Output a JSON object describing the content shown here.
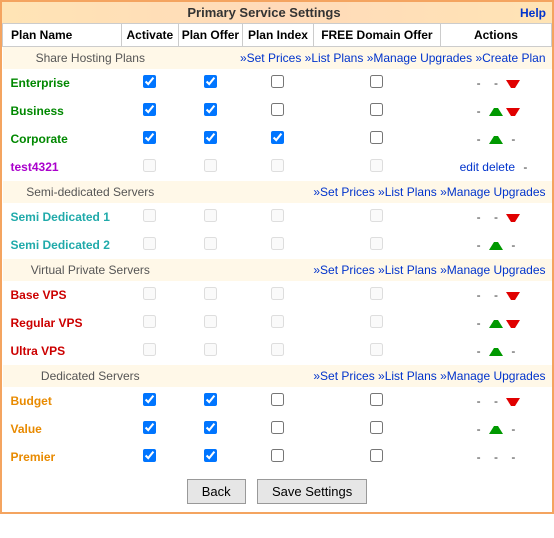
{
  "title": "Primary Service Settings",
  "help_label": "Help",
  "columns": {
    "plan_name": "Plan Name",
    "activate": "Activate",
    "plan_offer": "Plan Offer",
    "plan_index": "Plan Index",
    "free_domain": "FREE Domain Offer",
    "actions": "Actions"
  },
  "groups": [
    {
      "name": "Share Hosting Plans",
      "links": [
        {
          "text": "»Set Prices",
          "key": "set-prices"
        },
        {
          "text": "»List Plans",
          "key": "list-plans"
        },
        {
          "text": "»Manage Upgrades",
          "key": "manage-upgrades"
        },
        {
          "text": "»Create Plan",
          "key": "create-plan"
        }
      ],
      "rows": [
        {
          "name": "Enterprise",
          "css": "c-green",
          "activate": true,
          "offer": true,
          "index": false,
          "free": false,
          "disabled": false,
          "actions": [
            {
              "t": "dash"
            },
            {
              "t": "dash"
            },
            {
              "t": "down"
            }
          ]
        },
        {
          "name": "Business",
          "css": "c-green",
          "activate": true,
          "offer": true,
          "index": false,
          "free": false,
          "disabled": false,
          "actions": [
            {
              "t": "dash"
            },
            {
              "t": "up"
            },
            {
              "t": "down"
            }
          ]
        },
        {
          "name": "Corporate",
          "css": "c-green",
          "activate": true,
          "offer": true,
          "index": true,
          "free": false,
          "disabled": false,
          "actions": [
            {
              "t": "dash"
            },
            {
              "t": "up"
            },
            {
              "t": "dash"
            }
          ]
        },
        {
          "name": "test4321",
          "css": "c-purple",
          "activate": false,
          "offer": false,
          "index": false,
          "free": false,
          "disabled": true,
          "actions": [
            {
              "t": "link",
              "text": "edit"
            },
            {
              "t": "link",
              "text": "delete"
            },
            {
              "t": "dash"
            }
          ]
        }
      ]
    },
    {
      "name": "Semi-dedicated Servers",
      "links": [
        {
          "text": "»Set Prices",
          "key": "set-prices"
        },
        {
          "text": "»List Plans",
          "key": "list-plans"
        },
        {
          "text": "»Manage Upgrades",
          "key": "manage-upgrades"
        }
      ],
      "rows": [
        {
          "name": "Semi Dedicated 1",
          "css": "c-teal",
          "activate": false,
          "offer": false,
          "index": false,
          "free": false,
          "disabled": true,
          "actions": [
            {
              "t": "dash"
            },
            {
              "t": "dash"
            },
            {
              "t": "down"
            }
          ]
        },
        {
          "name": "Semi Dedicated 2",
          "css": "c-teal",
          "activate": false,
          "offer": false,
          "index": false,
          "free": false,
          "disabled": true,
          "actions": [
            {
              "t": "dash"
            },
            {
              "t": "up"
            },
            {
              "t": "dash"
            }
          ]
        }
      ]
    },
    {
      "name": "Virtual Private Servers",
      "links": [
        {
          "text": "»Set Prices",
          "key": "set-prices"
        },
        {
          "text": "»List Plans",
          "key": "list-plans"
        },
        {
          "text": "»Manage Upgrades",
          "key": "manage-upgrades"
        }
      ],
      "rows": [
        {
          "name": "Base VPS",
          "css": "c-red",
          "activate": false,
          "offer": false,
          "index": false,
          "free": false,
          "disabled": true,
          "actions": [
            {
              "t": "dash"
            },
            {
              "t": "dash"
            },
            {
              "t": "down"
            }
          ]
        },
        {
          "name": "Regular VPS",
          "css": "c-red",
          "activate": false,
          "offer": false,
          "index": false,
          "free": false,
          "disabled": true,
          "actions": [
            {
              "t": "dash"
            },
            {
              "t": "up"
            },
            {
              "t": "down"
            }
          ]
        },
        {
          "name": "Ultra VPS",
          "css": "c-red",
          "activate": false,
          "offer": false,
          "index": false,
          "free": false,
          "disabled": true,
          "actions": [
            {
              "t": "dash"
            },
            {
              "t": "up"
            },
            {
              "t": "dash"
            }
          ]
        }
      ]
    },
    {
      "name": "Dedicated Servers",
      "links": [
        {
          "text": "»Set Prices",
          "key": "set-prices"
        },
        {
          "text": "»List Plans",
          "key": "list-plans"
        },
        {
          "text": "»Manage Upgrades",
          "key": "manage-upgrades"
        }
      ],
      "rows": [
        {
          "name": "Budget",
          "css": "c-orange",
          "activate": true,
          "offer": true,
          "index": false,
          "free": false,
          "disabled": false,
          "actions": [
            {
              "t": "dash"
            },
            {
              "t": "dash"
            },
            {
              "t": "down"
            }
          ]
        },
        {
          "name": "Value",
          "css": "c-orange",
          "activate": true,
          "offer": true,
          "index": false,
          "free": false,
          "disabled": false,
          "actions": [
            {
              "t": "dash"
            },
            {
              "t": "up"
            },
            {
              "t": "dash"
            }
          ]
        },
        {
          "name": "Premier",
          "css": "c-orange",
          "activate": true,
          "offer": true,
          "index": false,
          "free": false,
          "disabled": false,
          "actions": [
            {
              "t": "dash"
            },
            {
              "t": "dash"
            },
            {
              "t": "dash"
            }
          ]
        }
      ]
    }
  ],
  "buttons": {
    "back": "Back",
    "save": "Save Settings"
  },
  "dash": "-"
}
